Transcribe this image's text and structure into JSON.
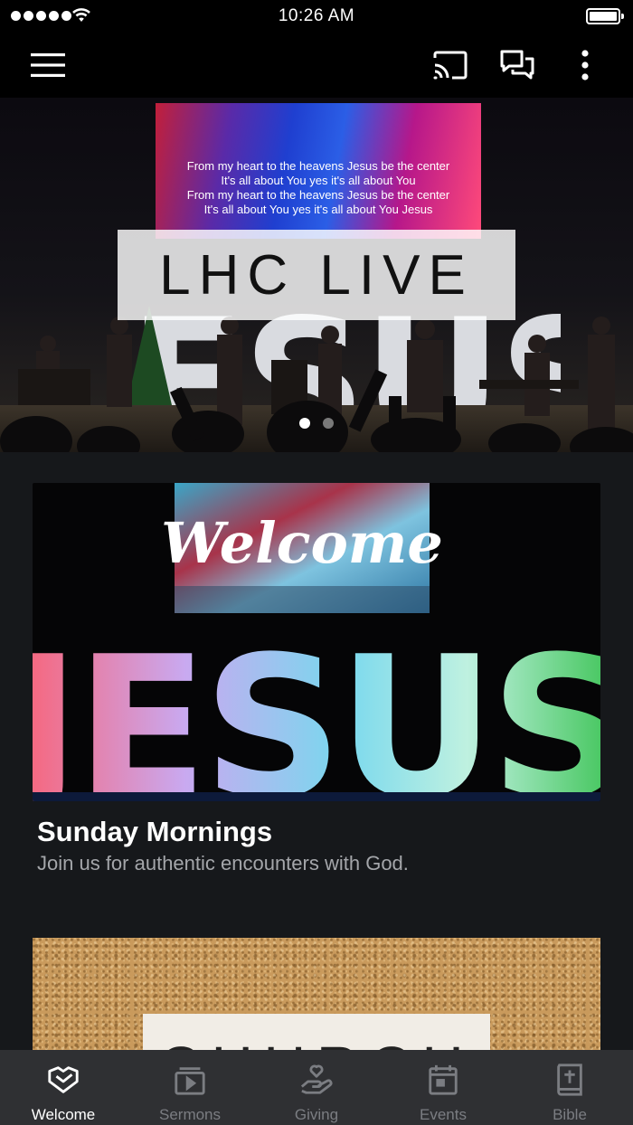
{
  "status_bar": {
    "time": "10:26 AM"
  },
  "app_bar": {
    "icons": [
      "menu-icon",
      "cast-icon",
      "chat-icon",
      "more-vert-icon"
    ]
  },
  "hero": {
    "banner_text": "LHC LIVE",
    "screen_lyrics": [
      "From my heart to the heavens Jesus be the center",
      "It's all about You yes it's all about You",
      "From my heart to the heavens Jesus be the center",
      "It's all about You yes it's all about You Jesus"
    ],
    "stage_letters": "JESUS",
    "carousel": {
      "count": 2,
      "active": 1
    }
  },
  "cards": [
    {
      "image_screen_text": "Welcome",
      "image_letters": "JESUS",
      "title": "Sunday Mornings",
      "subtitle": "Join us for authentic encounters with God."
    },
    {
      "image_text": "CHURCH"
    }
  ],
  "tabs": [
    {
      "label": "Welcome",
      "icon": "heart-hands-icon",
      "active": true
    },
    {
      "label": "Sermons",
      "icon": "video-library-icon",
      "active": false
    },
    {
      "label": "Giving",
      "icon": "giving-hand-icon",
      "active": false
    },
    {
      "label": "Events",
      "icon": "calendar-icon",
      "active": false
    },
    {
      "label": "Bible",
      "icon": "bible-icon",
      "active": false
    }
  ],
  "colors": {
    "background": "#16181b",
    "tab_bar": "#2f3033",
    "subtitle": "#a4a6aa",
    "tab_inactive": "#7b7d82"
  }
}
